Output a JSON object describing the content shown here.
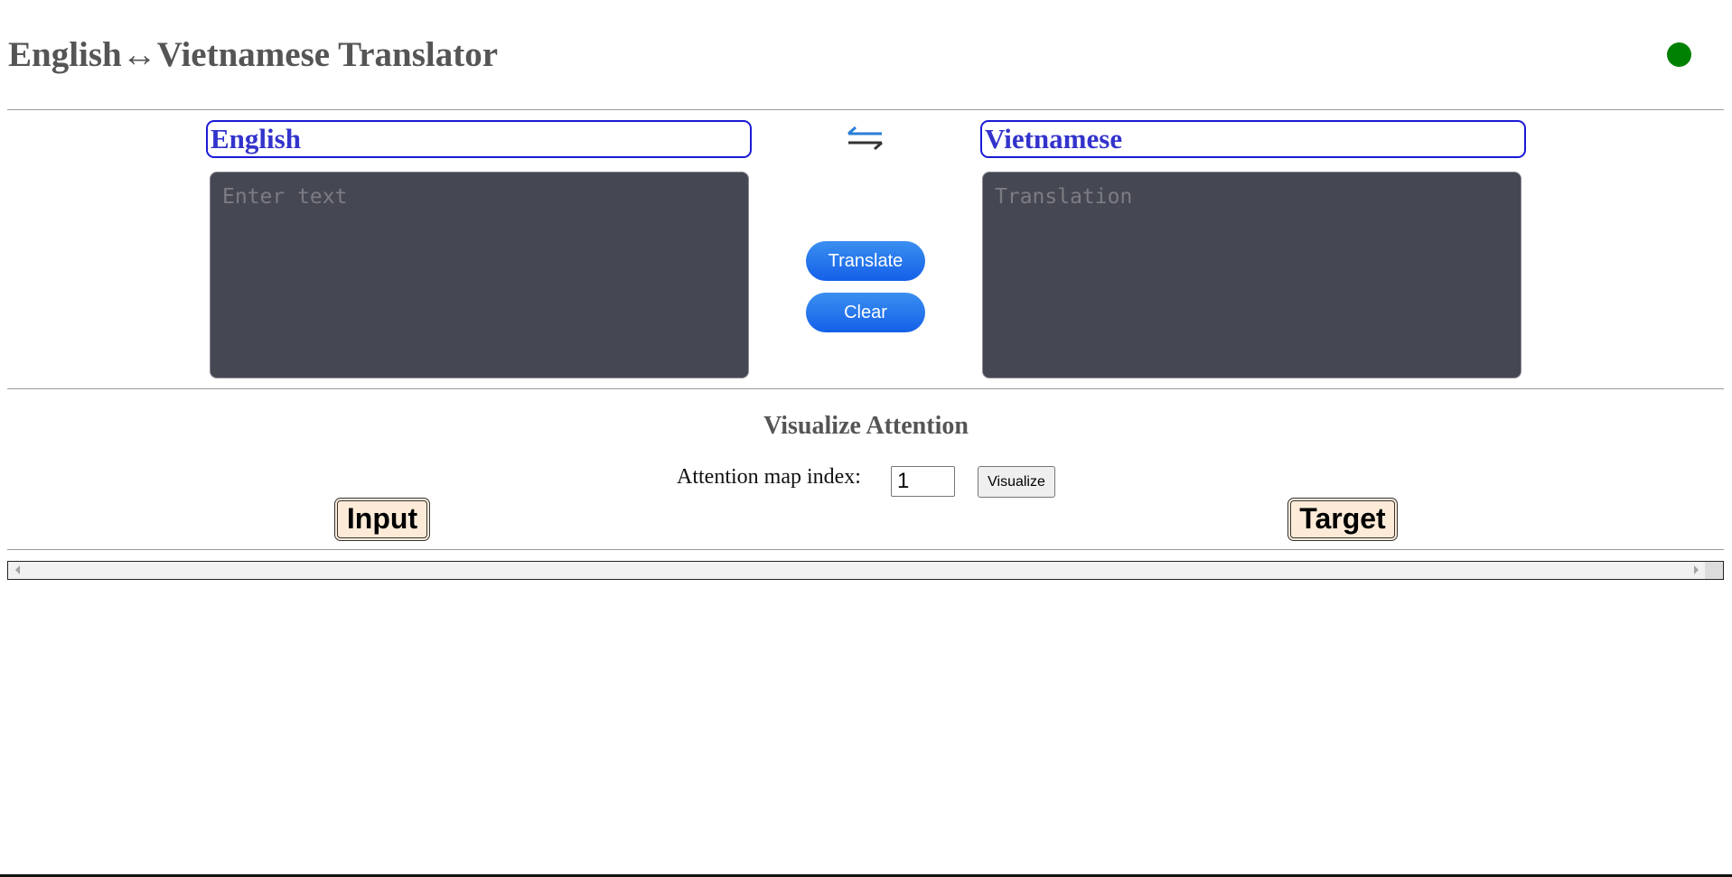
{
  "app": {
    "title": "English↔Vietnamese Translator",
    "status_color": "#008000"
  },
  "translator": {
    "source_language": "English",
    "target_language": "Vietnamese",
    "source_placeholder": "Enter text",
    "target_placeholder": "Translation",
    "swap_icon": "swap-arrows-icon",
    "translate_label": "Translate",
    "clear_label": "Clear",
    "accent_color": "#1a1ad6",
    "button_color": "#1f6fe8"
  },
  "attention": {
    "heading": "Visualize Attention",
    "index_label": "Attention map index:",
    "index_value": "1",
    "visualize_label": "Visualize",
    "input_label": "Input",
    "target_label": "Target"
  }
}
